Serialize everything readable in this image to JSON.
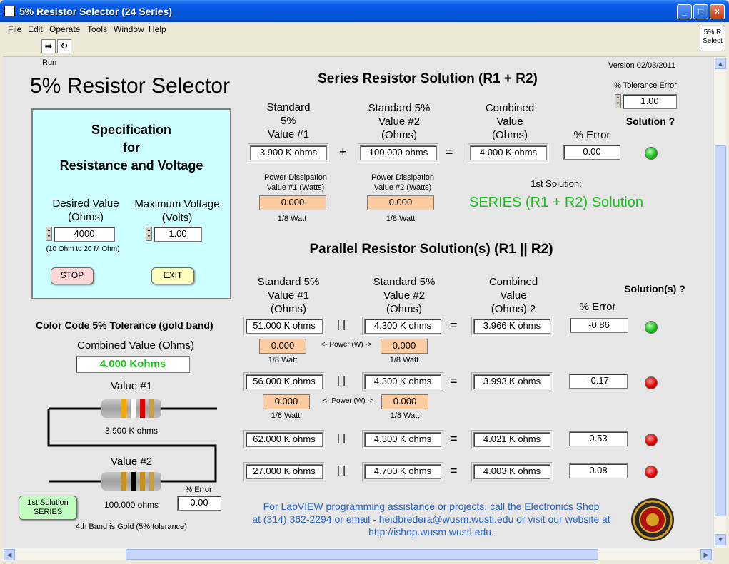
{
  "window": {
    "title": "5% Resistor Selector (24 Series)",
    "menus": [
      "File",
      "Edit",
      "Operate",
      "Tools",
      "Window",
      "Help"
    ],
    "vi_icon_text": "5% R Select"
  },
  "panel": {
    "run_label": "Run",
    "app_title": "5% Resistor Selector",
    "version": "Version 02/03/2011",
    "spec": {
      "heading_line1": "Specification",
      "heading_line2": "for",
      "heading_line3": "Resistance and Voltage",
      "desired_label_1": "Desired Value",
      "desired_label_2": "(Ohms)",
      "desired_value": "4000",
      "desired_range": "(10 Ohm to 20 M Ohm)",
      "maxv_label_1": "Maximum Voltage",
      "maxv_label_2": "(Volts)",
      "maxv_value": "1.00",
      "stop_label": "STOP",
      "exit_label": "EXIT"
    },
    "color_code": {
      "heading": "Color Code 5% Tolerance (gold band)",
      "combined_label": "Combined Value (Ohms)",
      "combined_value": "4.000 Kohms",
      "value1_label": "Value #1",
      "value1_text": "3.900 K ohms",
      "value2_label": "Value #2",
      "value2_text": "100.000 ohms",
      "fourth_band": "4th Band is Gold (5% tolerance)",
      "error_label": "% Error",
      "error_value": "0.00",
      "solution_button_line1": "1st Solution",
      "solution_button_line2": "SERIES",
      "r1_bands": [
        "#f5a800",
        "#ffffff",
        "#e00000"
      ],
      "r2_bands": [
        "#c8901c",
        "#000000",
        "#c8901c"
      ]
    },
    "series": {
      "heading": "Series Resistor Solution (R1 + R2)",
      "tol_label": "% Tolerance Error",
      "tol_value": "1.00",
      "col1_l1": "Standard",
      "col1_l2": "5%",
      "col1_l3": "Value #1",
      "col2_l1": "Standard 5%",
      "col2_l2": "Value #2",
      "col2_l3": "(Ohms)",
      "col3_l1": "Combined",
      "col3_l2": "Value",
      "col3_l3": "(Ohms)",
      "col4": "% Error",
      "col5": "Solution ?",
      "v1": "3.900 K ohms",
      "v2": "100.000 ohms",
      "combined": "4.000 K ohms",
      "error": "0.00",
      "plus": "+",
      "equals": "=",
      "pd1_l1": "Power Dissipation",
      "pd1_l2": "Value #1 (Watts)",
      "pd1_value": "0.000",
      "pd1_rating": "1/8 Watt",
      "pd2_l1": "Power Dissipation",
      "pd2_l2": "Value #2 (Watts)",
      "pd2_value": "0.000",
      "pd2_rating": "1/8 Watt",
      "first_solution_label": "1st Solution:",
      "first_solution_value": "SERIES (R1 + R2) Solution"
    },
    "parallel": {
      "heading": "Parallel Resistor Solution(s) (R1 || R2)",
      "col1_l1": "Standard 5%",
      "col1_l2": "Value #1",
      "col1_l3": "(Ohms)",
      "col2_l1": "Standard 5%",
      "col2_l2": "Value #2",
      "col2_l3": "(Ohms)",
      "col3_l1": "Combined",
      "col3_l2": "Value",
      "col3_l3": "(Ohms) 2",
      "col4": "% Error",
      "col5": "Solution(s) ?",
      "par": "| |",
      "equals": "=",
      "power_label": "<- Power (W) ->",
      "rows": [
        {
          "v1": "51.000 K ohms",
          "v2": "4.300 K ohms",
          "combined": "3.966 K ohms",
          "error": "-0.86",
          "led": "green",
          "p1": "0.000",
          "p1r": "1/8 Watt",
          "p2": "0.000",
          "p2r": "1/8 Watt"
        },
        {
          "v1": "56.000 K ohms",
          "v2": "4.300 K ohms",
          "combined": "3.993 K ohms",
          "error": "-0.17",
          "led": "red",
          "p1": "0.000",
          "p1r": "1/8 Watt",
          "p2": "0.000",
          "p2r": "1/8 Watt"
        },
        {
          "v1": "62.000 K ohms",
          "v2": "4.300 K ohms",
          "combined": "4.021 K ohms",
          "error": "0.53",
          "led": "red"
        },
        {
          "v1": "27.000 K ohms",
          "v2": "4.700 K ohms",
          "combined": "4.003 K ohms",
          "error": "0.08",
          "led": "red"
        }
      ]
    },
    "footer": {
      "line1": "For LabVIEW programming assistance or projects, call the Electronics Shop",
      "line2": "at (314) 362-2294 or email - heidbredera@wusm.wustl.edu or visit our website at",
      "line3": "http://ishop.wusm.wustl.edu."
    },
    "colors": {
      "accent_green": "#19c019",
      "footer_blue": "#2a63c8",
      "spec_bg": "#ccffff"
    }
  }
}
